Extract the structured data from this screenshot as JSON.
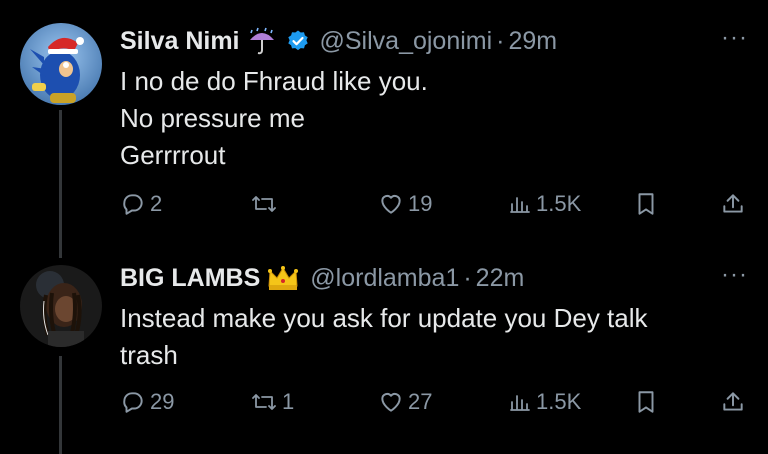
{
  "tweets": [
    {
      "name": "Silva Nimi",
      "handle": "@Silva_ojonimi",
      "separator": "·",
      "time": "29m",
      "lines": [
        "I no de do Fhraud like you.",
        "No pressure me",
        "Gerrrrout"
      ],
      "replies": "2",
      "reposts": "",
      "likes": "19",
      "views": "1.5K",
      "name_emoji": "umbrella-rain-icon",
      "verified": true
    },
    {
      "name": "BIG LAMBS",
      "handle": "@lordlamba1",
      "separator": "·",
      "time": "22m",
      "lines": [
        "Instead make you ask for update you Dey talk",
        "trash"
      ],
      "replies": "29",
      "reposts": "1",
      "likes": "27",
      "views": "1.5K",
      "name_emoji": "crown-icon",
      "verified": false
    }
  ],
  "more_label": "···",
  "colors": {
    "background": "#000000",
    "text": "#e7e9ea",
    "muted": "#8b98a5",
    "verified": "#1d9bf0"
  }
}
